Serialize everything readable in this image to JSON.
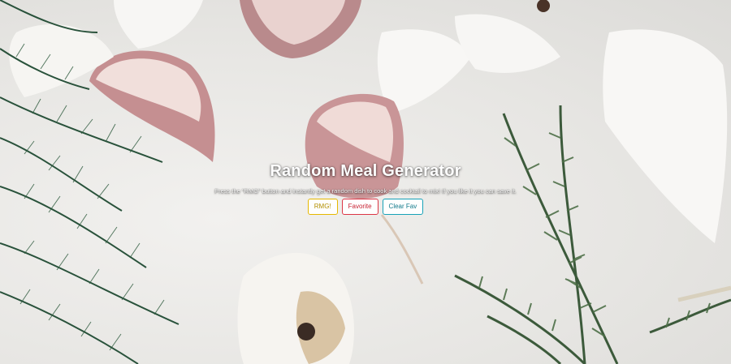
{
  "hero": {
    "title": "Random Meal Generator",
    "subtitle": "Press the \"RMG\" button and instantly get a random dish to cook and cocktail to mix! If you like it you can save it."
  },
  "buttons": {
    "rmg_label": "RMG!",
    "favorite_label": "Favorite",
    "clear_fav_label": "Clear Fav"
  },
  "colors": {
    "rmg": "#e6b800",
    "favorite": "#dc3545",
    "clear_fav": "#17a2b8"
  }
}
